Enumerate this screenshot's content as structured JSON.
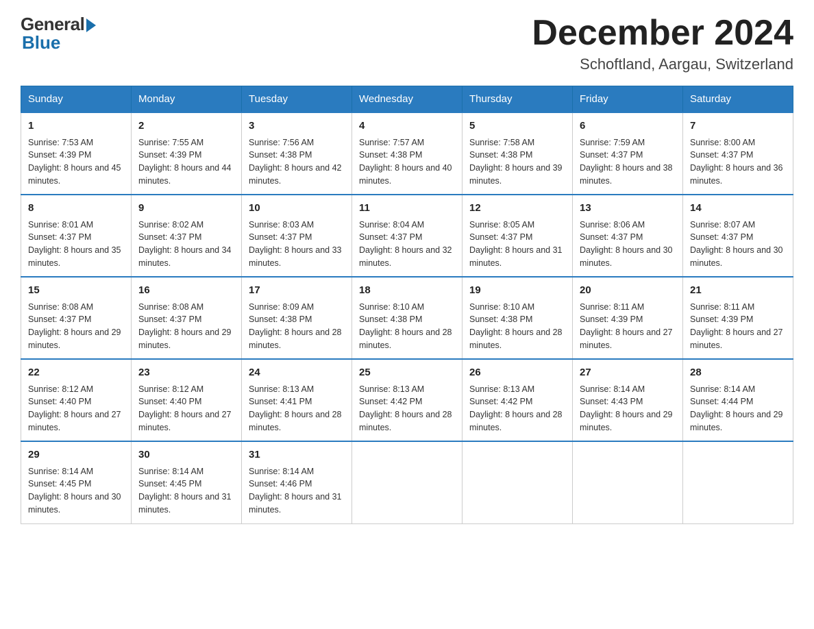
{
  "header": {
    "logo_general": "General",
    "logo_blue": "Blue",
    "month_title": "December 2024",
    "location": "Schoftland, Aargau, Switzerland"
  },
  "days_of_week": [
    "Sunday",
    "Monday",
    "Tuesday",
    "Wednesday",
    "Thursday",
    "Friday",
    "Saturday"
  ],
  "weeks": [
    [
      {
        "day": "1",
        "sunrise": "7:53 AM",
        "sunset": "4:39 PM",
        "daylight": "8 hours and 45 minutes."
      },
      {
        "day": "2",
        "sunrise": "7:55 AM",
        "sunset": "4:39 PM",
        "daylight": "8 hours and 44 minutes."
      },
      {
        "day": "3",
        "sunrise": "7:56 AM",
        "sunset": "4:38 PM",
        "daylight": "8 hours and 42 minutes."
      },
      {
        "day": "4",
        "sunrise": "7:57 AM",
        "sunset": "4:38 PM",
        "daylight": "8 hours and 40 minutes."
      },
      {
        "day": "5",
        "sunrise": "7:58 AM",
        "sunset": "4:38 PM",
        "daylight": "8 hours and 39 minutes."
      },
      {
        "day": "6",
        "sunrise": "7:59 AM",
        "sunset": "4:37 PM",
        "daylight": "8 hours and 38 minutes."
      },
      {
        "day": "7",
        "sunrise": "8:00 AM",
        "sunset": "4:37 PM",
        "daylight": "8 hours and 36 minutes."
      }
    ],
    [
      {
        "day": "8",
        "sunrise": "8:01 AM",
        "sunset": "4:37 PM",
        "daylight": "8 hours and 35 minutes."
      },
      {
        "day": "9",
        "sunrise": "8:02 AM",
        "sunset": "4:37 PM",
        "daylight": "8 hours and 34 minutes."
      },
      {
        "day": "10",
        "sunrise": "8:03 AM",
        "sunset": "4:37 PM",
        "daylight": "8 hours and 33 minutes."
      },
      {
        "day": "11",
        "sunrise": "8:04 AM",
        "sunset": "4:37 PM",
        "daylight": "8 hours and 32 minutes."
      },
      {
        "day": "12",
        "sunrise": "8:05 AM",
        "sunset": "4:37 PM",
        "daylight": "8 hours and 31 minutes."
      },
      {
        "day": "13",
        "sunrise": "8:06 AM",
        "sunset": "4:37 PM",
        "daylight": "8 hours and 30 minutes."
      },
      {
        "day": "14",
        "sunrise": "8:07 AM",
        "sunset": "4:37 PM",
        "daylight": "8 hours and 30 minutes."
      }
    ],
    [
      {
        "day": "15",
        "sunrise": "8:08 AM",
        "sunset": "4:37 PM",
        "daylight": "8 hours and 29 minutes."
      },
      {
        "day": "16",
        "sunrise": "8:08 AM",
        "sunset": "4:37 PM",
        "daylight": "8 hours and 29 minutes."
      },
      {
        "day": "17",
        "sunrise": "8:09 AM",
        "sunset": "4:38 PM",
        "daylight": "8 hours and 28 minutes."
      },
      {
        "day": "18",
        "sunrise": "8:10 AM",
        "sunset": "4:38 PM",
        "daylight": "8 hours and 28 minutes."
      },
      {
        "day": "19",
        "sunrise": "8:10 AM",
        "sunset": "4:38 PM",
        "daylight": "8 hours and 28 minutes."
      },
      {
        "day": "20",
        "sunrise": "8:11 AM",
        "sunset": "4:39 PM",
        "daylight": "8 hours and 27 minutes."
      },
      {
        "day": "21",
        "sunrise": "8:11 AM",
        "sunset": "4:39 PM",
        "daylight": "8 hours and 27 minutes."
      }
    ],
    [
      {
        "day": "22",
        "sunrise": "8:12 AM",
        "sunset": "4:40 PM",
        "daylight": "8 hours and 27 minutes."
      },
      {
        "day": "23",
        "sunrise": "8:12 AM",
        "sunset": "4:40 PM",
        "daylight": "8 hours and 27 minutes."
      },
      {
        "day": "24",
        "sunrise": "8:13 AM",
        "sunset": "4:41 PM",
        "daylight": "8 hours and 28 minutes."
      },
      {
        "day": "25",
        "sunrise": "8:13 AM",
        "sunset": "4:42 PM",
        "daylight": "8 hours and 28 minutes."
      },
      {
        "day": "26",
        "sunrise": "8:13 AM",
        "sunset": "4:42 PM",
        "daylight": "8 hours and 28 minutes."
      },
      {
        "day": "27",
        "sunrise": "8:14 AM",
        "sunset": "4:43 PM",
        "daylight": "8 hours and 29 minutes."
      },
      {
        "day": "28",
        "sunrise": "8:14 AM",
        "sunset": "4:44 PM",
        "daylight": "8 hours and 29 minutes."
      }
    ],
    [
      {
        "day": "29",
        "sunrise": "8:14 AM",
        "sunset": "4:45 PM",
        "daylight": "8 hours and 30 minutes."
      },
      {
        "day": "30",
        "sunrise": "8:14 AM",
        "sunset": "4:45 PM",
        "daylight": "8 hours and 31 minutes."
      },
      {
        "day": "31",
        "sunrise": "8:14 AM",
        "sunset": "4:46 PM",
        "daylight": "8 hours and 31 minutes."
      },
      null,
      null,
      null,
      null
    ]
  ]
}
